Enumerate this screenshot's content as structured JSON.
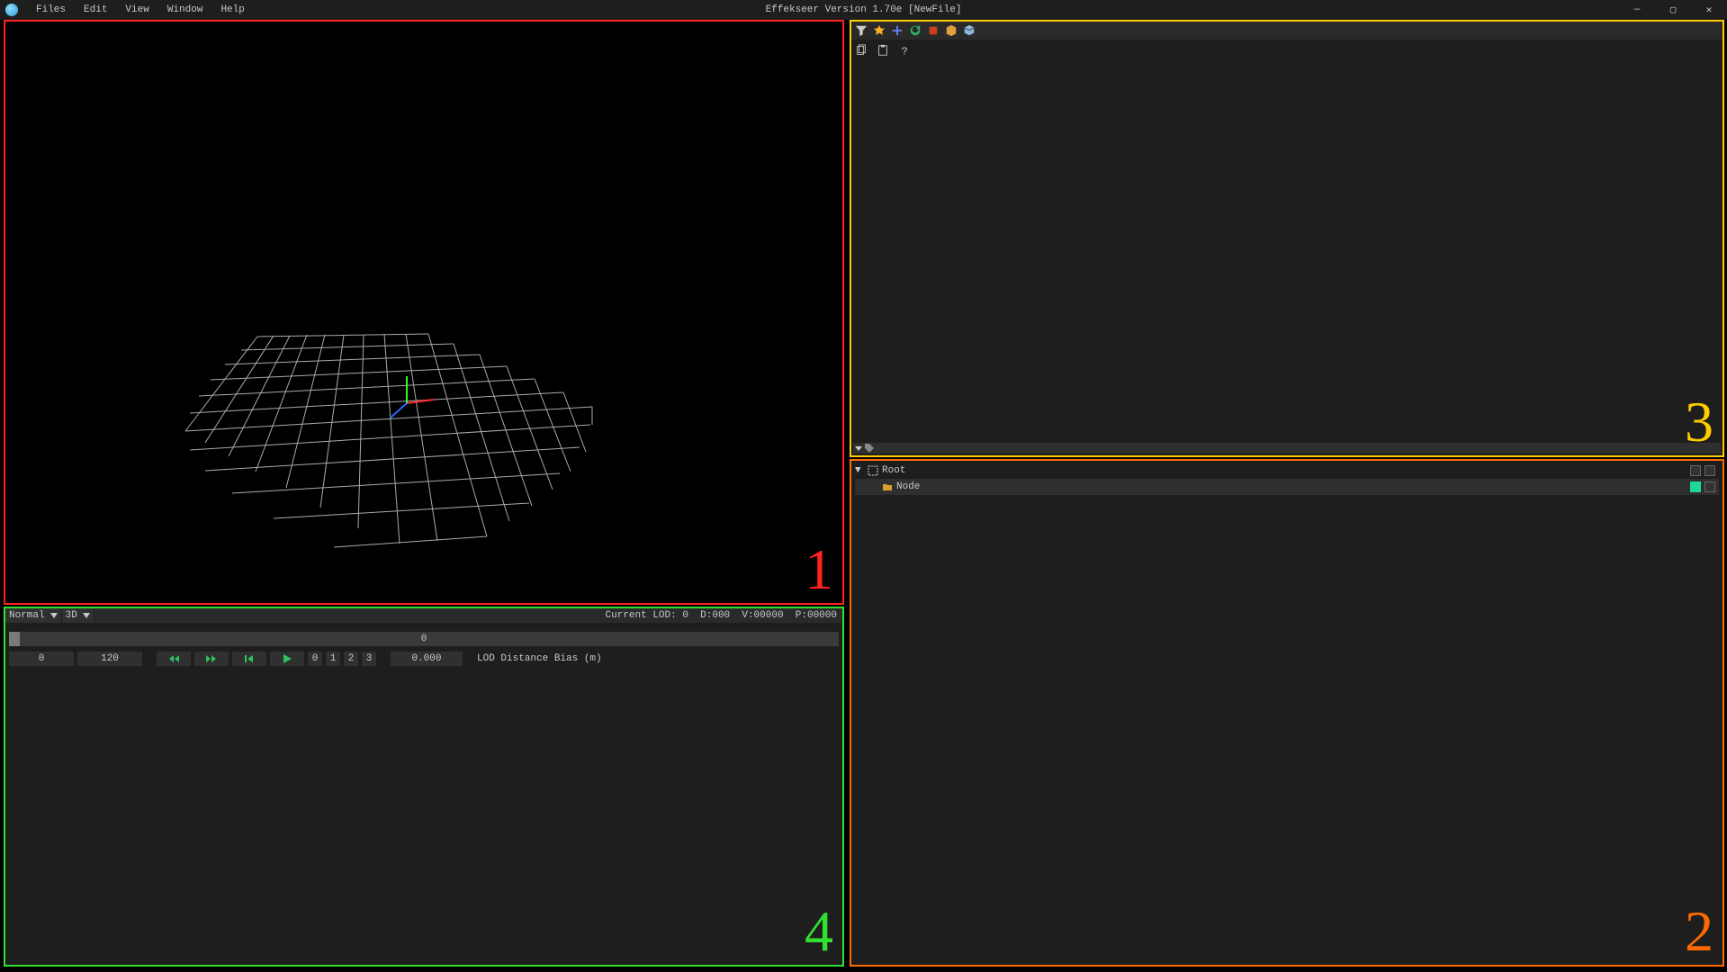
{
  "window": {
    "title": "Effekseer Version 1.70e [NewFile]",
    "controls": {
      "minimize": "—",
      "maximize": "▢",
      "close": "✕"
    }
  },
  "menubar": {
    "items": [
      "Files",
      "Edit",
      "View",
      "Window",
      "Help"
    ]
  },
  "panel_labels": {
    "viewport": "1",
    "nodetree": "2",
    "inspector": "3",
    "timeline": "4"
  },
  "inspector_toolbar": {
    "icons": [
      "filter",
      "favorite",
      "add",
      "refresh",
      "record",
      "package",
      "cube"
    ],
    "row2": [
      "copy",
      "paste",
      "help"
    ]
  },
  "nodetree": {
    "root": {
      "label": "Root",
      "expanded": true
    },
    "children": [
      {
        "label": "Node",
        "icon": "folder",
        "active": true
      }
    ]
  },
  "timeline": {
    "mode_dropdown": "Normal",
    "view_dropdown": "3D",
    "status": {
      "current_lod": "Current LOD: 0",
      "d": "D:000",
      "v": "V:00000",
      "p": "P:00000"
    },
    "track_center": "0",
    "frame_start": "0",
    "frame_end": "120",
    "lod_buttons": [
      "0",
      "1",
      "2",
      "3"
    ],
    "lod_bias_value": "0.000",
    "lod_bias_label": "LOD Distance Bias (m)"
  }
}
